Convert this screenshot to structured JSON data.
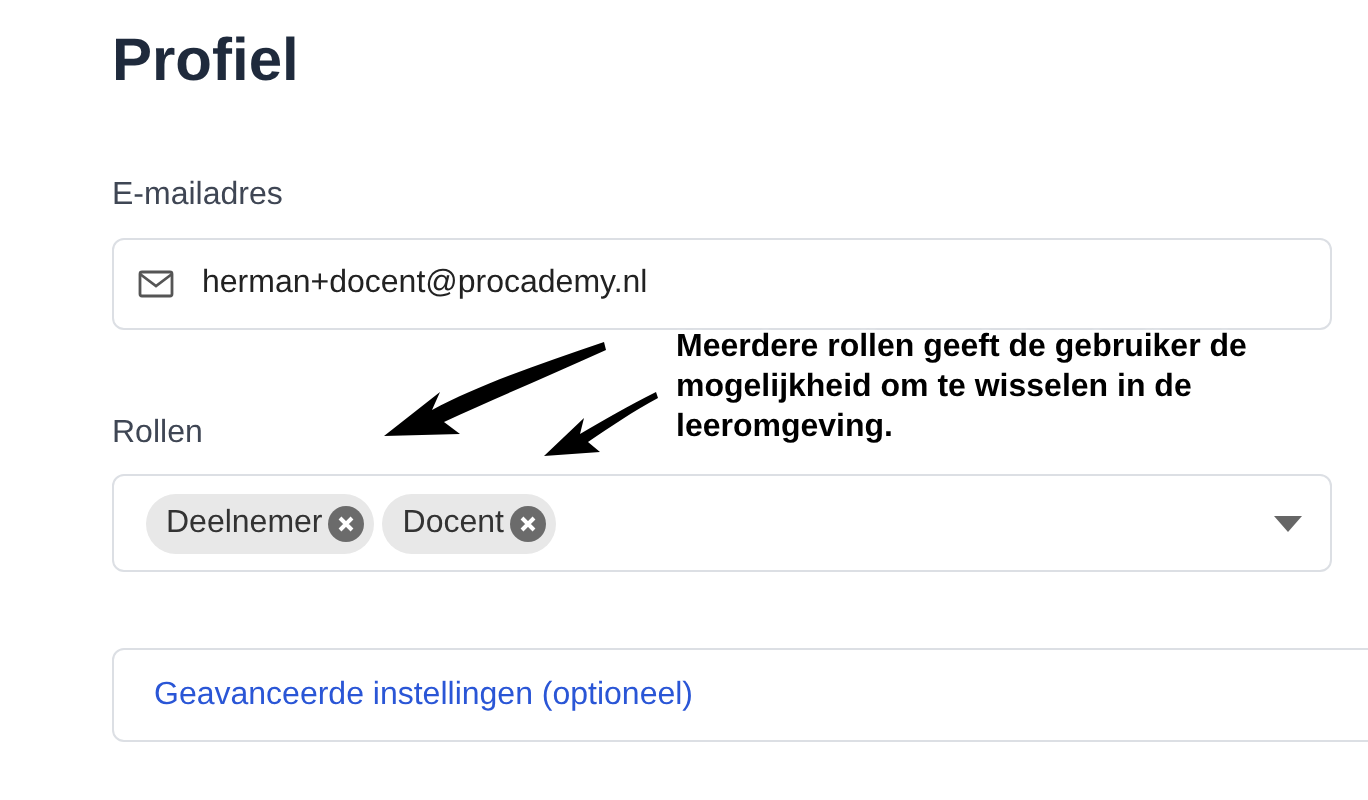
{
  "title": "Profiel",
  "email": {
    "label": "E-mailadres",
    "value": "herman+docent@procademy.nl"
  },
  "roles": {
    "label": "Rollen",
    "chips": [
      {
        "label": "Deelnemer"
      },
      {
        "label": "Docent"
      }
    ]
  },
  "advanced": {
    "label": "Geavanceerde instellingen (optioneel)"
  },
  "annotation": {
    "text": "Meerdere rollen geeft de gebruiker de mogelijkheid om te wisselen in de leeromgeving."
  }
}
